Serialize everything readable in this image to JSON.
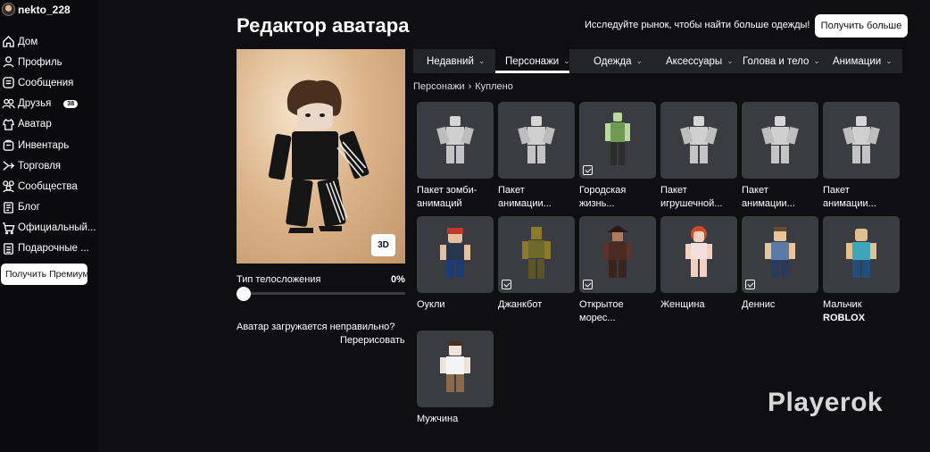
{
  "user": {
    "name": "nekto_228"
  },
  "sidebar": {
    "items": [
      {
        "label": "Дом",
        "icon": "home-icon"
      },
      {
        "label": "Профиль",
        "icon": "person-icon"
      },
      {
        "label": "Сообщения",
        "icon": "messages-icon"
      },
      {
        "label": "Друзья",
        "icon": "friends-icon",
        "badge": "38"
      },
      {
        "label": "Аватар",
        "icon": "avatar-icon"
      },
      {
        "label": "Инвентарь",
        "icon": "inventory-icon"
      },
      {
        "label": "Торговля",
        "icon": "trade-icon"
      },
      {
        "label": "Сообщества",
        "icon": "groups-icon"
      },
      {
        "label": "Блог",
        "icon": "blog-icon"
      },
      {
        "label": "Официальный...",
        "icon": "cart-icon"
      },
      {
        "label": "Подарочные ...",
        "icon": "gift-card-icon"
      }
    ],
    "premium_button": "Получить Премиум"
  },
  "header": {
    "title": "Редактор аватара",
    "market_text": "Исследуйте рынок, чтобы найти больше одежды!",
    "get_more": "Получить больше"
  },
  "preview": {
    "btn_3d": "3D",
    "body_type_label": "Тип телосложения",
    "body_type_value": "0%",
    "body_type_level": 0,
    "bad_avatar_text": "Аватар загружается неправильно?",
    "redraw": "Перерисовать"
  },
  "tabs": [
    {
      "label": "Недавний",
      "active": false
    },
    {
      "label": "Персонажи",
      "active": true
    },
    {
      "label": "Одежда",
      "active": false
    },
    {
      "label": "Аксессуары",
      "active": false
    },
    {
      "label": "Голова и тело",
      "active": false
    },
    {
      "label": "Анимации",
      "active": false
    }
  ],
  "breadcrumb": {
    "parent": "Персонажи",
    "sep": "›",
    "current": "Куплено"
  },
  "items": [
    {
      "line1": "Пакет зомби-",
      "line2": "анимаций",
      "kind": "white",
      "buy": false
    },
    {
      "line1": "Пакет",
      "line2": "анимации...",
      "kind": "white",
      "buy": false
    },
    {
      "line1": "Городская",
      "line2": "жизнь...",
      "kind": "green",
      "buy": true
    },
    {
      "line1": "Пакет",
      "line2": "игрушечной...",
      "kind": "white",
      "buy": false
    },
    {
      "line1": "Пакет",
      "line2": "анимации...",
      "kind": "white",
      "buy": false
    },
    {
      "line1": "Пакет",
      "line2": "анимации...",
      "kind": "white",
      "buy": false
    },
    {
      "line1": "Оукли",
      "line2": "",
      "kind": "oakley",
      "buy": false
    },
    {
      "line1": "Джанкбот",
      "line2": "",
      "kind": "junkbot",
      "buy": true
    },
    {
      "line1": "Открытое",
      "line2": "морес...",
      "kind": "pirate",
      "buy": true
    },
    {
      "line1": "Женщина",
      "line2": "",
      "kind": "woman",
      "buy": false
    },
    {
      "line1": "Деннис",
      "line2": "",
      "kind": "dennis",
      "buy": true
    },
    {
      "line1": "Мальчик",
      "line2": "ROBLOX",
      "kind": "boy",
      "buy": false
    },
    {
      "line1": "Мужчина",
      "line2": "",
      "kind": "man",
      "buy": false
    }
  ],
  "watermark": "Playerok",
  "colors": {
    "background": "#0f0f12",
    "tab_bar": "#232428",
    "card": "#3b3c42",
    "preview_bg": "#dcb58c"
  }
}
